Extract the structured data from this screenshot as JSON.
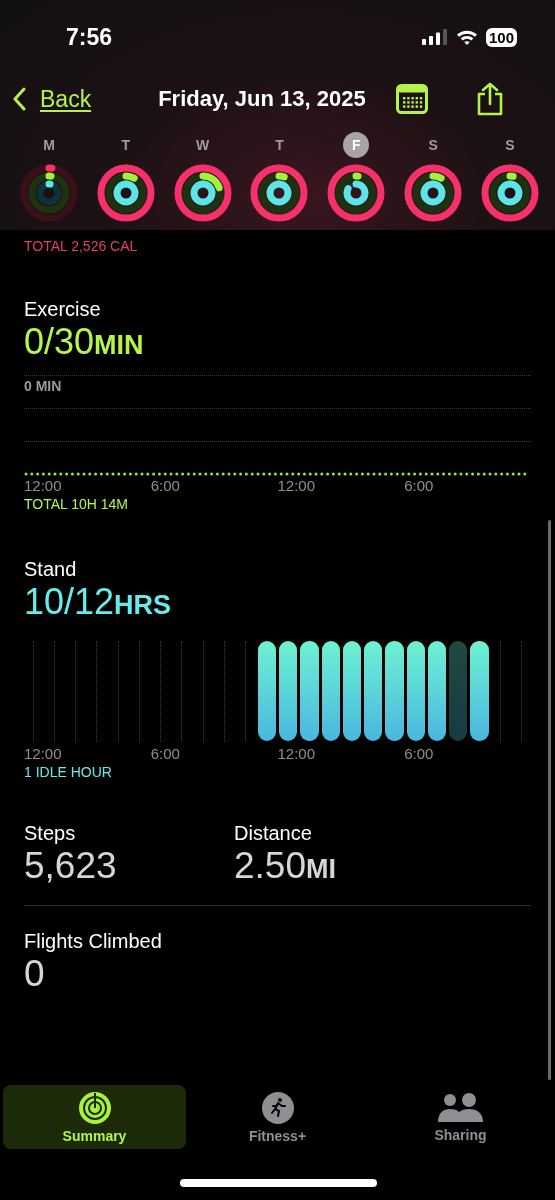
{
  "status_bar": {
    "time": "7:56",
    "battery": "100"
  },
  "nav": {
    "back": "Back",
    "title": "Friday, Jun 13, 2025"
  },
  "week": [
    {
      "day": "M",
      "selected": false
    },
    {
      "day": "T",
      "selected": false
    },
    {
      "day": "W",
      "selected": false
    },
    {
      "day": "T",
      "selected": false
    },
    {
      "day": "F",
      "selected": true
    },
    {
      "day": "S",
      "selected": false
    },
    {
      "day": "S",
      "selected": false
    }
  ],
  "move": {
    "total": "TOTAL 2,526 CAL"
  },
  "exercise": {
    "label": "Exercise",
    "value": "0/30",
    "unit": "MIN",
    "scale": "0 MIN",
    "axis": [
      "12:00",
      "6:00",
      "12:00",
      "6:00"
    ],
    "total": "TOTAL 10H 14M"
  },
  "stand": {
    "label": "Stand",
    "value": "10/12",
    "unit": "HRS",
    "hours": [
      {
        "kind": "empty"
      },
      {
        "kind": "empty"
      },
      {
        "kind": "empty"
      },
      {
        "kind": "empty"
      },
      {
        "kind": "empty"
      },
      {
        "kind": "empty"
      },
      {
        "kind": "empty"
      },
      {
        "kind": "empty"
      },
      {
        "kind": "empty"
      },
      {
        "kind": "empty"
      },
      {
        "kind": "empty"
      },
      {
        "kind": "stood"
      },
      {
        "kind": "stood"
      },
      {
        "kind": "stood"
      },
      {
        "kind": "stood"
      },
      {
        "kind": "stood"
      },
      {
        "kind": "stood"
      },
      {
        "kind": "stood"
      },
      {
        "kind": "stood"
      },
      {
        "kind": "stood"
      },
      {
        "kind": "idle"
      },
      {
        "kind": "stood"
      },
      {
        "kind": "empty"
      },
      {
        "kind": "empty"
      }
    ],
    "axis": [
      "12:00",
      "6:00",
      "12:00",
      "6:00"
    ],
    "total": "1 IDLE HOUR"
  },
  "stats": [
    {
      "label": "Steps",
      "value": "5,623"
    },
    {
      "label": "Distance",
      "value": "2.50",
      "unit": "MI"
    }
  ],
  "flights": {
    "label": "Flights Climbed",
    "value": "0"
  },
  "tabs": [
    {
      "label": "Summary",
      "selected": true
    },
    {
      "label": "Fitness+",
      "selected": false
    },
    {
      "label": "Sharing",
      "selected": false
    }
  ]
}
